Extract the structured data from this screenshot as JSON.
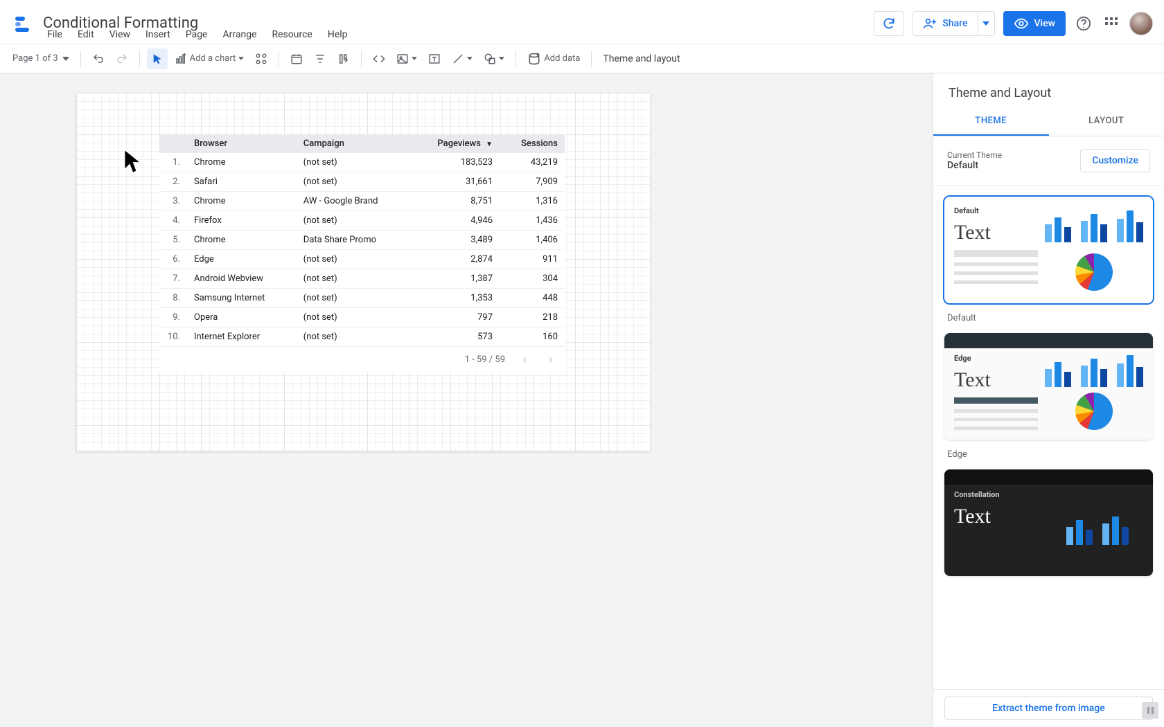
{
  "header": {
    "doc_title": "Conditional Formatting",
    "refresh_tooltip": "Refresh",
    "share_label": "Share",
    "view_label": "View"
  },
  "menubar": [
    "File",
    "Edit",
    "View",
    "Insert",
    "Page",
    "Arrange",
    "Resource",
    "Help"
  ],
  "toolbar": {
    "page_selector": "Page 1 of 3",
    "add_chart": "Add a chart",
    "add_data": "Add data",
    "theme_layout": "Theme and layout"
  },
  "table": {
    "headers": [
      "",
      "Browser",
      "Campaign",
      "Pageviews",
      "Sessions"
    ],
    "sort_col": "Pageviews",
    "rows": [
      {
        "n": "1.",
        "browser": "Chrome",
        "campaign": "(not set)",
        "pageviews": "183,523",
        "sessions": "43,219"
      },
      {
        "n": "2.",
        "browser": "Safari",
        "campaign": "(not set)",
        "pageviews": "31,661",
        "sessions": "7,909"
      },
      {
        "n": "3.",
        "browser": "Chrome",
        "campaign": "AW - Google Brand",
        "pageviews": "8,751",
        "sessions": "1,316"
      },
      {
        "n": "4.",
        "browser": "Firefox",
        "campaign": "(not set)",
        "pageviews": "4,946",
        "sessions": "1,436"
      },
      {
        "n": "5.",
        "browser": "Chrome",
        "campaign": "Data Share Promo",
        "pageviews": "3,489",
        "sessions": "1,406"
      },
      {
        "n": "6.",
        "browser": "Edge",
        "campaign": "(not set)",
        "pageviews": "2,874",
        "sessions": "911"
      },
      {
        "n": "7.",
        "browser": "Android Webview",
        "campaign": "(not set)",
        "pageviews": "1,387",
        "sessions": "304"
      },
      {
        "n": "8.",
        "browser": "Samsung Internet",
        "campaign": "(not set)",
        "pageviews": "1,353",
        "sessions": "448"
      },
      {
        "n": "9.",
        "browser": "Opera",
        "campaign": "(not set)",
        "pageviews": "797",
        "sessions": "218"
      },
      {
        "n": "10.",
        "browser": "Internet Explorer",
        "campaign": "(not set)",
        "pageviews": "573",
        "sessions": "160"
      }
    ],
    "pager": "1 - 59 / 59"
  },
  "sidepanel": {
    "title": "Theme and Layout",
    "tab_theme": "THEME",
    "tab_layout": "LAYOUT",
    "current_label": "Current Theme",
    "current_value": "Default",
    "customize": "Customize",
    "themes": [
      {
        "name": "Default",
        "label": "Default",
        "big": "Text"
      },
      {
        "name": "Edge",
        "label": "Edge",
        "big": "Text"
      },
      {
        "name": "Constellation",
        "label": "Constellation",
        "big": "Text"
      }
    ],
    "extract": "Extract theme from image"
  }
}
